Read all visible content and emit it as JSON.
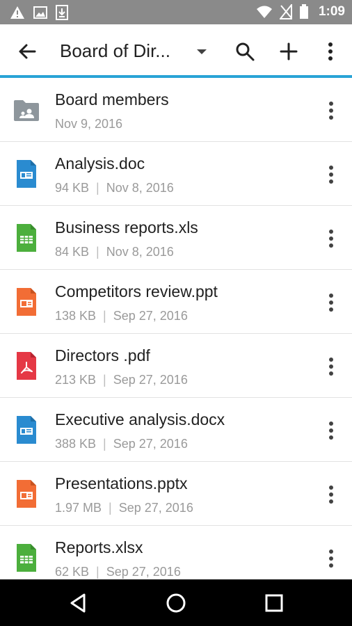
{
  "status_bar": {
    "time": "1:09",
    "icons": [
      "warning-icon",
      "image-icon",
      "download-icon",
      "wifi-icon",
      "no-sim-icon",
      "battery-icon"
    ]
  },
  "app_bar": {
    "title": "Board of Dir...",
    "icons": [
      "back-arrow-icon",
      "dropdown-caret-icon",
      "search-icon",
      "add-icon",
      "more-vert-icon"
    ],
    "accent_color": "#29a3d6"
  },
  "files": [
    {
      "name": "Board members",
      "type": "folder",
      "size": "",
      "date": "Nov 9, 2016",
      "color": "#8e969c"
    },
    {
      "name": "Analysis.doc",
      "type": "doc",
      "size": "94 KB",
      "date": "Nov 8, 2016",
      "color": "#2a8bd0"
    },
    {
      "name": "Business reports.xls",
      "type": "xls",
      "size": "84 KB",
      "date": "Nov 8, 2016",
      "color": "#4caf3d"
    },
    {
      "name": "Competitors review.ppt",
      "type": "ppt",
      "size": "138 KB",
      "date": "Sep 27, 2016",
      "color": "#f26d35"
    },
    {
      "name": "Directors .pdf",
      "type": "pdf",
      "size": "213 KB",
      "date": "Sep 27, 2016",
      "color": "#e53845"
    },
    {
      "name": "Executive analysis.docx",
      "type": "doc",
      "size": "388 KB",
      "date": "Sep 27, 2016",
      "color": "#2a8bd0"
    },
    {
      "name": "Presentations.pptx",
      "type": "ppt",
      "size": "1.97 MB",
      "date": "Sep 27, 2016",
      "color": "#f26d35"
    },
    {
      "name": "Reports.xlsx",
      "type": "xls",
      "size": "62 KB",
      "date": "Sep 27, 2016",
      "color": "#4caf3d"
    }
  ],
  "nav_bar": {
    "icons": [
      "back-triangle-icon",
      "home-circle-icon",
      "recents-square-icon"
    ]
  }
}
